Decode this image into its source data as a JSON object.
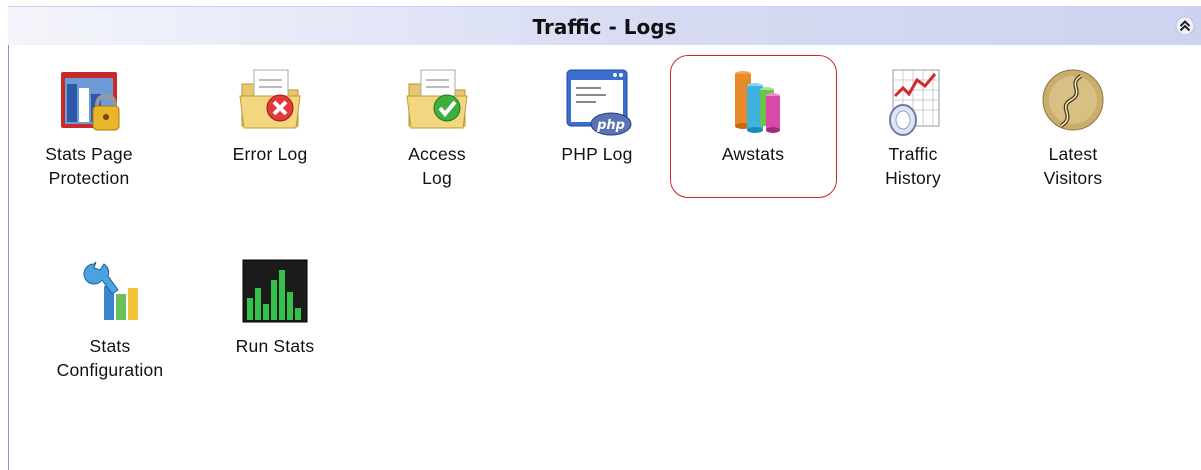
{
  "panel": {
    "title": "Traffic - Logs",
    "collapse_icon": "double-chevron-up-icon"
  },
  "row1": [
    {
      "label": "Stats Page\nProtection",
      "icon": "stats-page-protection-icon"
    },
    {
      "label": "Error Log",
      "icon": "error-log-icon"
    },
    {
      "label": "Access\nLog",
      "icon": "access-log-icon"
    },
    {
      "label": "PHP Log",
      "icon": "php-log-icon"
    },
    {
      "label": "Awstats",
      "icon": "awstats-icon"
    },
    {
      "label": "Traffic\nHistory",
      "icon": "traffic-history-icon"
    },
    {
      "label": "Latest\nVisitors",
      "icon": "latest-visitors-icon"
    }
  ],
  "row2": [
    {
      "label": "Stats\nConfiguration",
      "icon": "stats-configuration-icon"
    },
    {
      "label": "Run Stats",
      "icon": "run-stats-icon"
    }
  ],
  "highlight_color": "#d0262b"
}
